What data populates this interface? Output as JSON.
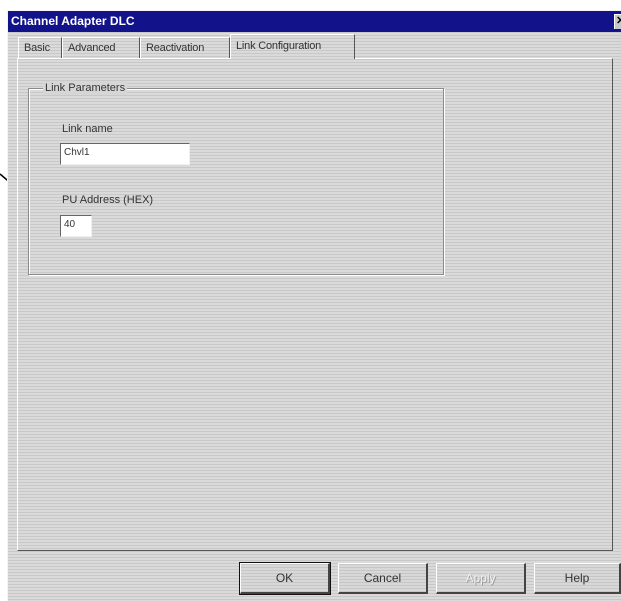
{
  "window": {
    "title": "Channel Adapter DLC",
    "close_glyph": "✕"
  },
  "tabs": [
    {
      "label": "Basic"
    },
    {
      "label": "Advanced"
    },
    {
      "label": "Reactivation"
    },
    {
      "label": "Link Configuration",
      "active": true
    }
  ],
  "group": {
    "legend": "Link Parameters",
    "link_name_label": "Link name",
    "link_name_value": "Chvl1",
    "pu_address_label": "PU Address (HEX)",
    "pu_address_value": "40"
  },
  "buttons": {
    "ok": "OK",
    "cancel": "Cancel",
    "apply": "Apply",
    "help": "Help"
  },
  "icons": {
    "annotation": "arrow-icon"
  },
  "colors": {
    "title_bar": "#12128a",
    "dialog_bg": "#d4d4d4"
  }
}
